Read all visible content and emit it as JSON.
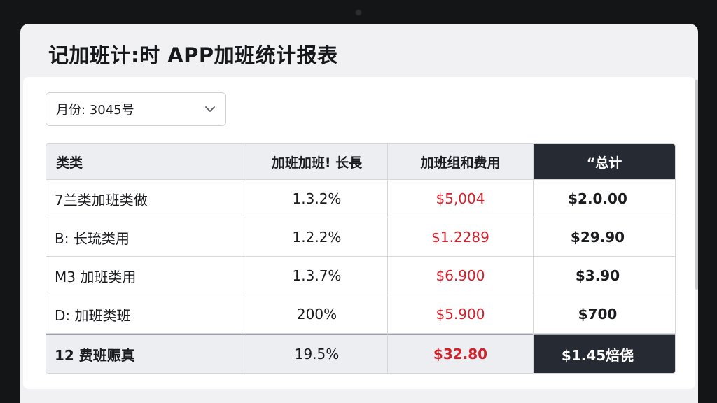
{
  "app": {
    "title": "记加班计:时 APP加班统计报表"
  },
  "filter": {
    "month_label": "月份:  3045号",
    "dropdown_icon": "chevron-down-icon"
  },
  "table": {
    "headers": [
      "类类",
      "加班加班! 长長",
      "加班组和费用",
      "“总计"
    ],
    "rows": [
      {
        "category": "7兰类加班类做",
        "hours": "1.3.2%",
        "cost": "$5,004",
        "total": "$2.0.00"
      },
      {
        "category": "B: 长琉类用",
        "hours": "1.2.2%",
        "cost": "$1.2289",
        "total": "$29.90"
      },
      {
        "category": "M3 加班类用",
        "hours": "1.3.7%",
        "cost": "$6.900",
        "total": "$3.90"
      },
      {
        "category": "D: 加班类班",
        "hours": "200%",
        "cost": "$5.900",
        "total": "$700"
      }
    ],
    "summary": {
      "category": "12 费班赈真",
      "hours": "19.5%",
      "cost": "$32.80",
      "total": "$1.45焙侥"
    }
  },
  "colors": {
    "accent_dark": "#262a33",
    "cost_red": "#d4202b",
    "header_bg": "#eceef1"
  }
}
